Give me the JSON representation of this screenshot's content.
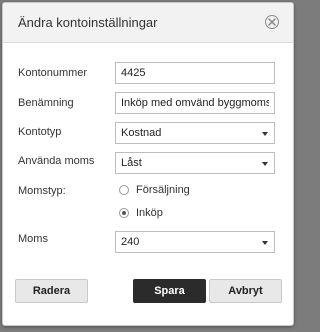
{
  "dialog": {
    "title": "Ändra kontoinställningar",
    "close_icon": "close-circle-icon"
  },
  "form": {
    "account_number": {
      "label": "Kontonummer",
      "value": "4425"
    },
    "name": {
      "label": "Benämning",
      "value": "Inköp med omvänd byggmoms"
    },
    "account_type": {
      "label": "Kontotyp",
      "value": "Kostnad"
    },
    "use_vat": {
      "label": "Använda moms",
      "value": "Låst"
    },
    "vat_type": {
      "label": "Momstyp:",
      "options": [
        {
          "label": "Försäljning",
          "checked": false
        },
        {
          "label": "Inköp",
          "checked": true
        }
      ]
    },
    "vat": {
      "label": "Moms",
      "value": "240"
    }
  },
  "buttons": {
    "delete": "Radera",
    "save": "Spara",
    "cancel": "Avbryt"
  },
  "colors": {
    "primary_button": "#2b2b2b",
    "secondary_button": "#e8e8e8",
    "header_bg": "#f2f2f2"
  }
}
